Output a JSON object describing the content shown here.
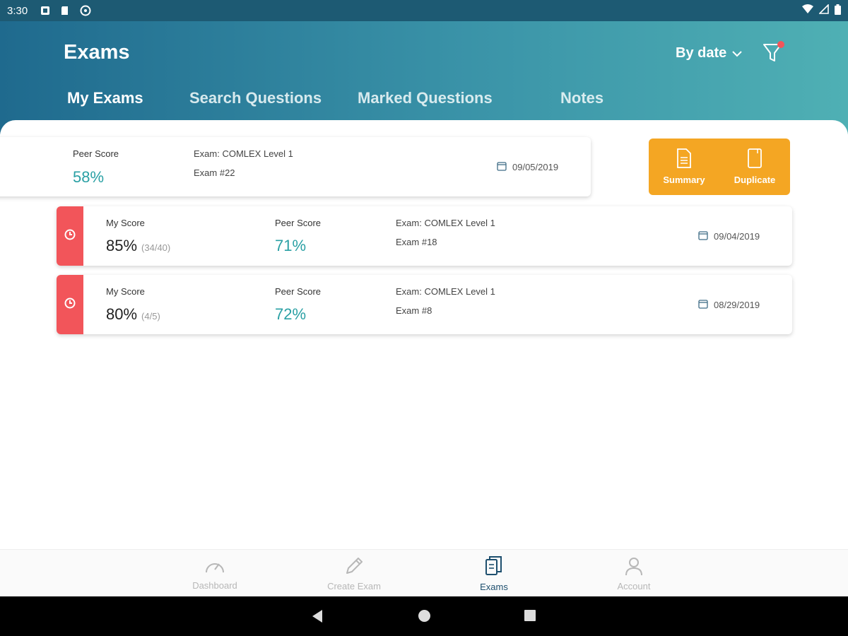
{
  "status_bar": {
    "time": "3:30"
  },
  "header": {
    "title": "Exams",
    "sort_label": "By date",
    "tabs": [
      {
        "label": "My Exams",
        "active": true
      },
      {
        "label": "Search Questions",
        "active": false
      },
      {
        "label": "Marked Questions",
        "active": false
      },
      {
        "label": "Notes",
        "active": false
      }
    ]
  },
  "exams": [
    {
      "peer_label": "Peer Score",
      "peer_score": "58%",
      "exam_name": "Exam: COMLEX Level 1",
      "exam_number": "Exam #22",
      "date": "09/05/2019"
    },
    {
      "my_label": "My Score",
      "my_score": "85%",
      "my_fraction": "(34/40)",
      "peer_label": "Peer Score",
      "peer_score": "71%",
      "exam_name": "Exam: COMLEX Level 1",
      "exam_number": "Exam #18",
      "date": "09/04/2019"
    },
    {
      "my_label": "My Score",
      "my_score": "80%",
      "my_fraction": "(4/5)",
      "peer_label": "Peer Score",
      "peer_score": "72%",
      "exam_name": "Exam: COMLEX Level 1",
      "exam_number": "Exam #8",
      "date": "08/29/2019"
    }
  ],
  "actions": {
    "summary": "Summary",
    "duplicate": "Duplicate"
  },
  "bottom_nav": [
    {
      "label": "Dashboard",
      "icon": "speedometer-icon",
      "active": false
    },
    {
      "label": "Create Exam",
      "icon": "pencil-icon",
      "active": false
    },
    {
      "label": "Exams",
      "icon": "documents-icon",
      "active": true
    },
    {
      "label": "Account",
      "icon": "user-icon",
      "active": false
    }
  ],
  "colors": {
    "accent_teal": "#2aa0a4",
    "action_orange": "#f4a623",
    "status_red": "#f2555a",
    "nav_active": "#1e4f6e"
  }
}
